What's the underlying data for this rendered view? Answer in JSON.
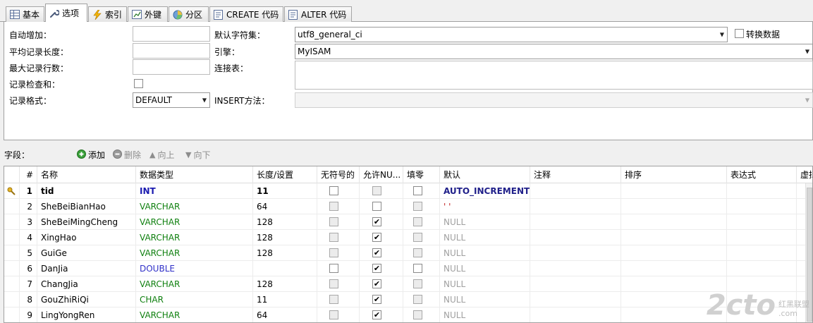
{
  "tabs": [
    {
      "label": "基本",
      "icon": "table-icon"
    },
    {
      "label": "选项",
      "icon": "wrench-icon"
    },
    {
      "label": "索引",
      "icon": "lightning-icon"
    },
    {
      "label": "外键",
      "icon": "foreign-key-icon"
    },
    {
      "label": "分区",
      "icon": "partition-icon"
    },
    {
      "label": "CREATE 代码",
      "icon": "code-icon"
    },
    {
      "label": "ALTER 代码",
      "icon": "code-icon"
    }
  ],
  "options": {
    "auto_increment_label": "自动增加：",
    "avg_row_length_label": "平均记录长度：",
    "max_rows_label": "最大记录行数：",
    "checksum_label": "记录检查和：",
    "row_format_label": "记录格式：",
    "row_format_value": "DEFAULT",
    "charset_label": "默认字符集：",
    "charset_value": "utf8_general_ci",
    "convert_data_label": "转换数据",
    "engine_label": "引擎：",
    "engine_value": "MyISAM",
    "union_label": "连接表：",
    "insert_method_label": "INSERT方法："
  },
  "fields_toolbar": {
    "label": "字段：",
    "add": "添加",
    "delete": "删除",
    "up": "向上",
    "down": "向下"
  },
  "columns": [
    "#",
    "名称",
    "数据类型",
    "长度/设置",
    "无符号的",
    "允许NU...",
    "填零",
    "默认",
    "注释",
    "排序",
    "表达式",
    "虚拟"
  ],
  "rows": [
    {
      "n": "1",
      "name": "tid",
      "type": "INT",
      "length": "11",
      "unsigned": "off",
      "nullable": "off-dis",
      "zerofill": "off",
      "default": "AUTO_INCREMENT",
      "key": true
    },
    {
      "n": "2",
      "name": "SheBeiBianHao",
      "type": "VARCHAR",
      "length": "64",
      "unsigned": "dis",
      "nullable": "off",
      "zerofill": "dis",
      "default": "' '"
    },
    {
      "n": "3",
      "name": "SheBeiMingCheng",
      "type": "VARCHAR",
      "length": "128",
      "unsigned": "dis",
      "nullable": "on",
      "zerofill": "dis",
      "default": "NULL"
    },
    {
      "n": "4",
      "name": "XingHao",
      "type": "VARCHAR",
      "length": "128",
      "unsigned": "dis",
      "nullable": "on",
      "zerofill": "dis",
      "default": "NULL"
    },
    {
      "n": "5",
      "name": "GuiGe",
      "type": "VARCHAR",
      "length": "128",
      "unsigned": "dis",
      "nullable": "on",
      "zerofill": "dis",
      "default": "NULL"
    },
    {
      "n": "6",
      "name": "DanJia",
      "type": "DOUBLE",
      "length": "",
      "unsigned": "off",
      "nullable": "on",
      "zerofill": "off",
      "default": "NULL"
    },
    {
      "n": "7",
      "name": "ChangJia",
      "type": "VARCHAR",
      "length": "128",
      "unsigned": "dis",
      "nullable": "on",
      "zerofill": "dis",
      "default": "NULL"
    },
    {
      "n": "8",
      "name": "GouZhiRiQi",
      "type": "CHAR",
      "length": "11",
      "unsigned": "dis",
      "nullable": "on",
      "zerofill": "dis",
      "default": "NULL"
    },
    {
      "n": "9",
      "name": "LingYongRen",
      "type": "VARCHAR",
      "length": "64",
      "unsigned": "dis",
      "nullable": "on",
      "zerofill": "dis",
      "default": "NULL"
    }
  ],
  "watermark": {
    "logo": "2cto",
    "line1": "红黑联盟",
    "line2": ".com"
  },
  "colors": {
    "accent_int": "#1a1ab0",
    "accent_varchar": "#108010",
    "null_gray": "#a0a0a0"
  }
}
